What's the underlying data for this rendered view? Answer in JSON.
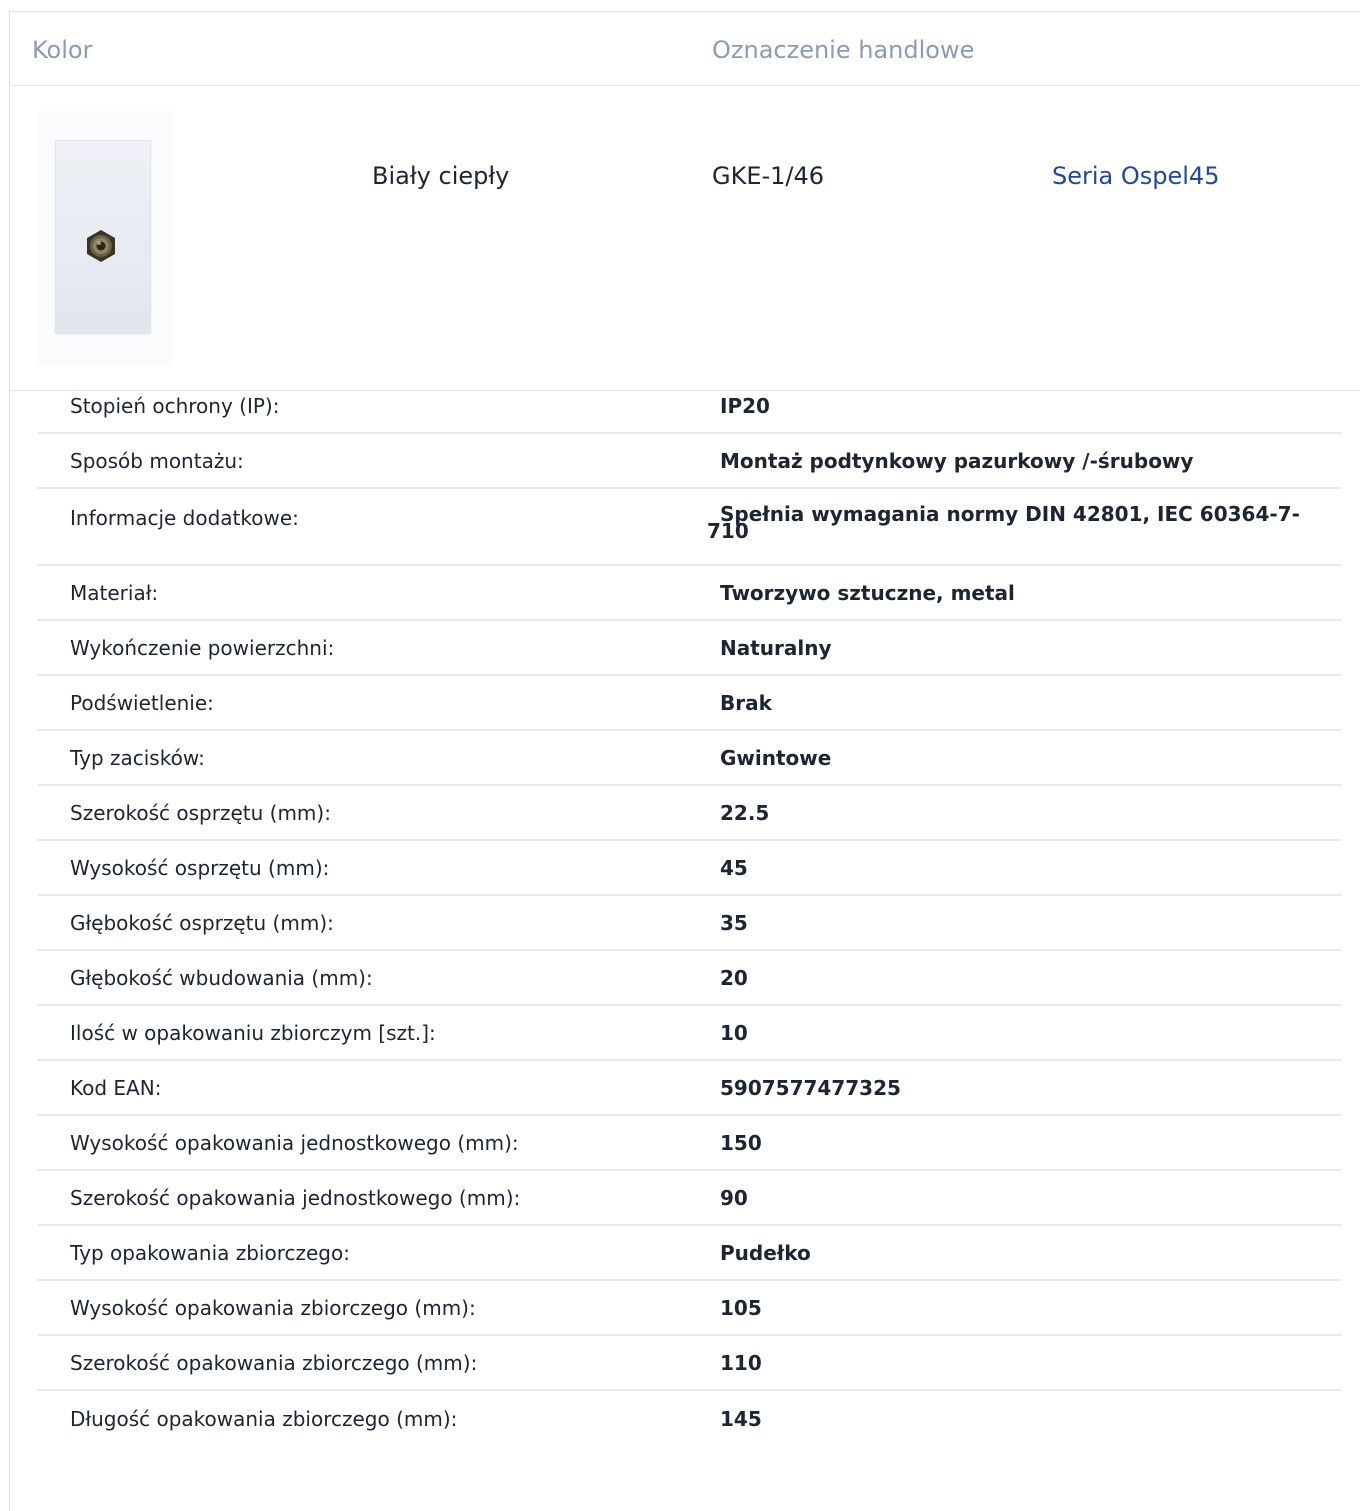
{
  "header": {
    "color_label": "Kolor",
    "trade_name_label": "Oznaczenie handlowe"
  },
  "product": {
    "image_icon": "wall-antenna-socket-image",
    "color": "Biały ciepły",
    "code": "GKE-1/46",
    "series_link": "Seria Ospel45"
  },
  "colors": {
    "header_text": "#8c9bb5",
    "link": "#1f4a93",
    "text": "#1d2433",
    "divider": "#e7eaee"
  },
  "specs": [
    {
      "label": "Stopień ochrony (IP):",
      "value": "IP20"
    },
    {
      "label": "Sposób montażu:",
      "value": "Montaż podtynkowy pazurkowy /-śrubowy"
    },
    {
      "label": "Informacje dodatkowe:",
      "value": "Spełnia wymagania normy DIN 42801, IEC 60364-7-710"
    },
    {
      "label": "Materiał:",
      "value": "Tworzywo sztuczne, metal"
    },
    {
      "label": "Wykończenie powierzchni:",
      "value": "Naturalny"
    },
    {
      "label": "Podświetlenie:",
      "value": "Brak"
    },
    {
      "label": "Typ zacisków:",
      "value": "Gwintowe"
    },
    {
      "label": "Szerokość osprzętu (mm):",
      "value": "22.5"
    },
    {
      "label": "Wysokość osprzętu (mm):",
      "value": "45"
    },
    {
      "label": "Głębokość osprzętu (mm):",
      "value": "35"
    },
    {
      "label": "Głębokość wbudowania (mm):",
      "value": "20"
    },
    {
      "label": "Ilość w opakowaniu zbiorczym [szt.]:",
      "value": "10"
    },
    {
      "label": "Kod EAN:",
      "value": "5907577477325"
    },
    {
      "label": "Wysokość opakowania jednostkowego (mm):",
      "value": "150"
    },
    {
      "label": "Szerokość opakowania jednostkowego (mm):",
      "value": "90"
    },
    {
      "label": "Typ opakowania zbiorczego:",
      "value": "Pudełko"
    },
    {
      "label": "Wysokość opakowania zbiorczego (mm):",
      "value": "105"
    },
    {
      "label": "Szerokość opakowania zbiorczego (mm):",
      "value": "110"
    },
    {
      "label": "Długość opakowania zbiorczego (mm):",
      "value": "145"
    }
  ]
}
